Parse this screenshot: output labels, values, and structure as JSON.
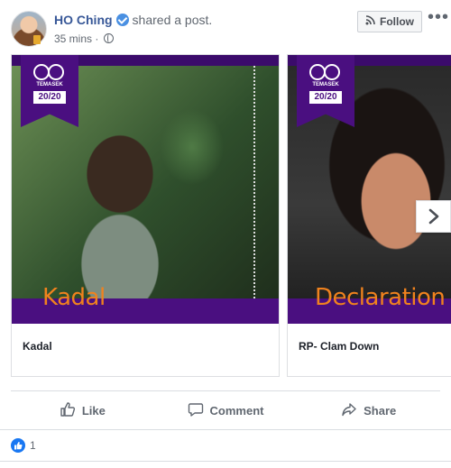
{
  "post": {
    "author": "HO Ching",
    "action": "shared a post.",
    "time": "35 mins",
    "separator": "·",
    "audience_icon": "globe-icon",
    "follow_label": "Follow",
    "more_label": "•••"
  },
  "carousel": {
    "cards": [
      {
        "poster_title": "Kadal",
        "caption": "Kadal",
        "logo_text": "TEMASEK",
        "logo_year": "20/20"
      },
      {
        "poster_title": "Declaration",
        "caption": "RP- Clam Down",
        "logo_text": "TEMASEK",
        "logo_year": "20/20"
      }
    ],
    "next_icon": "chevron-right-icon"
  },
  "actions": {
    "like": "Like",
    "comment": "Comment",
    "share": "Share"
  },
  "reactions": {
    "count": "1",
    "icon": "like-reaction-icon"
  },
  "colors": {
    "brand_blue": "#385898",
    "poster_purple": "#4a0f80",
    "poster_title": "#f0821e"
  }
}
